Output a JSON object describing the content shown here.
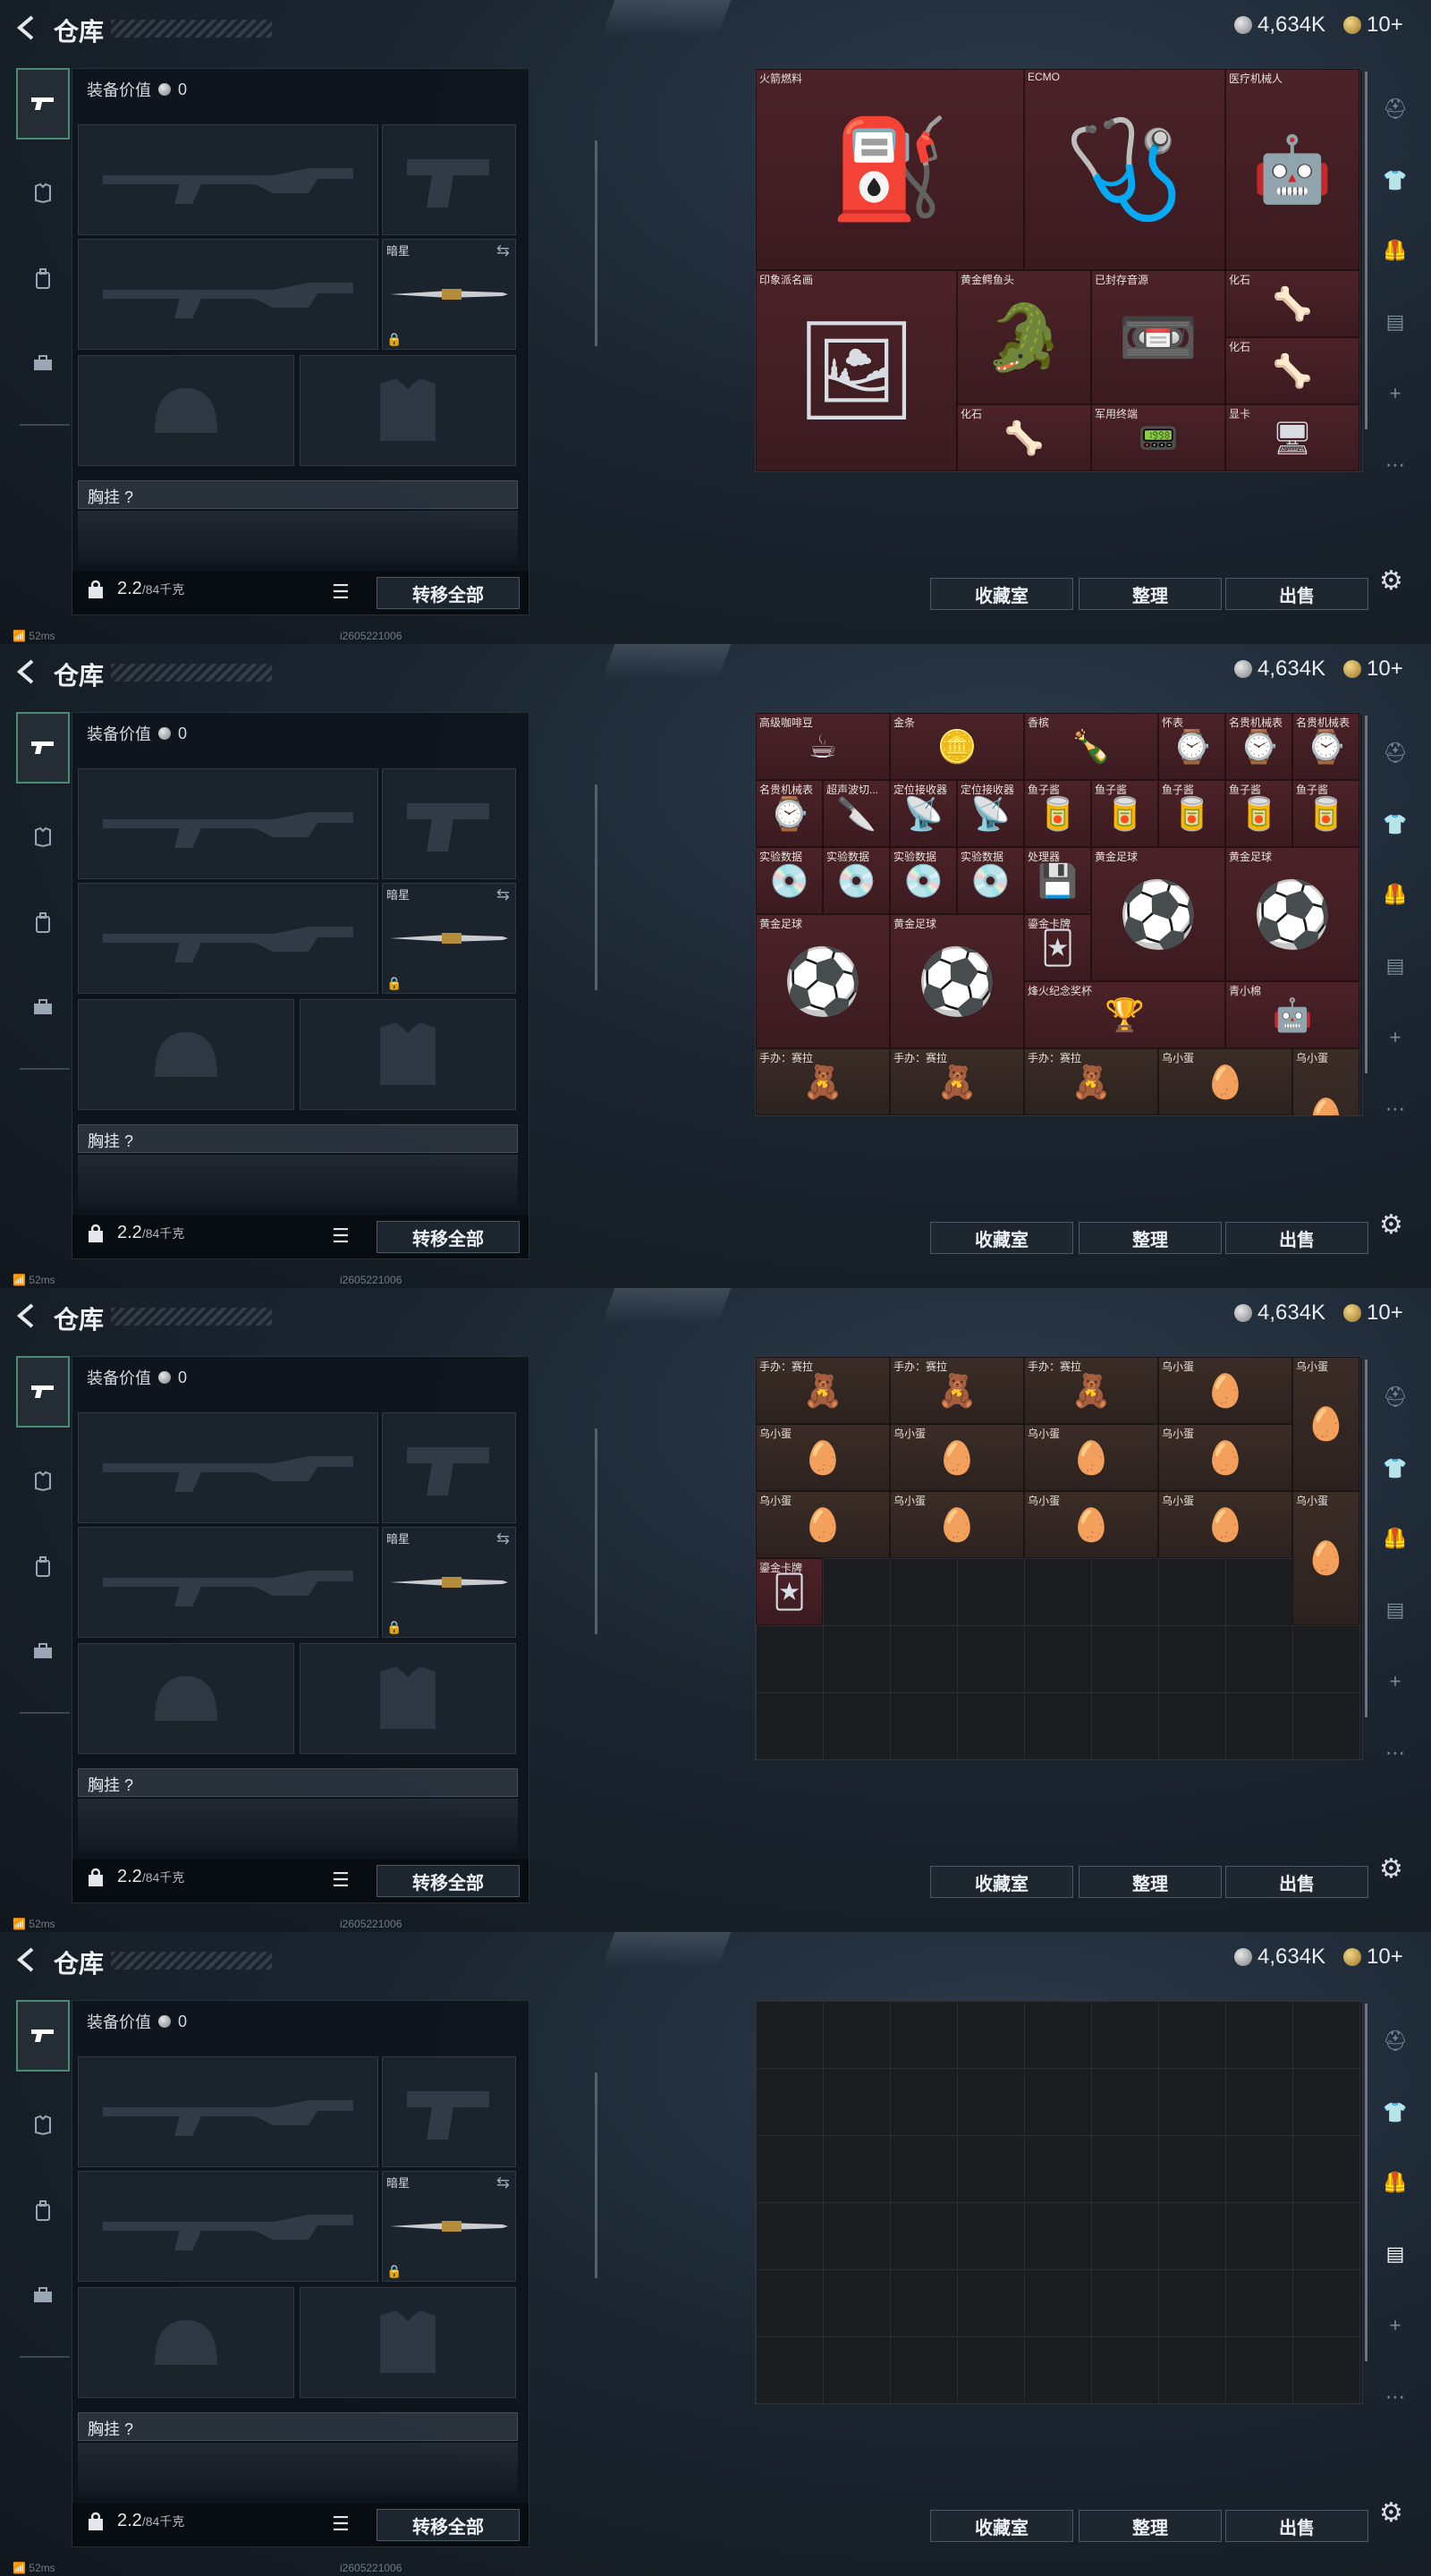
{
  "header": {
    "back_icon": "chevron-left-icon",
    "title": "仓库",
    "silver": "4,634K",
    "gold": "10+"
  },
  "left_tabs": [
    "pistol-icon",
    "armor-icon",
    "backpack-icon",
    "briefcase-icon"
  ],
  "equipment": {
    "value_label": "装备价值",
    "value": "0",
    "knife_label": "暗星",
    "chest_label": "胸挂 ?",
    "weight": "2.2",
    "weight_max": "/84千克",
    "transfer_all": "转移全部"
  },
  "status": {
    "ping": "52ms",
    "uid": "i2605221006"
  },
  "actions": {
    "collection": "收藏室",
    "sort": "整理",
    "sell": "出售"
  },
  "stash_pages": [
    {
      "items": [
        {
          "label": "火箭燃料",
          "glyph": "⛽",
          "color": "red",
          "c": 0,
          "r": 0,
          "w": 4,
          "h": 3
        },
        {
          "label": "ECMO",
          "glyph": "🩺",
          "color": "red",
          "c": 4,
          "r": 0,
          "w": 3,
          "h": 3
        },
        {
          "label": "医疗机械人",
          "glyph": "🤖",
          "color": "red",
          "c": 7,
          "r": 0,
          "w": 2,
          "h": 3
        },
        {
          "label": "印象派名画",
          "glyph": "🖼",
          "color": "red",
          "c": 0,
          "r": 3,
          "w": 3,
          "h": 3
        },
        {
          "label": "黄金鳄鱼头",
          "glyph": "🐊",
          "color": "red",
          "c": 3,
          "r": 3,
          "w": 2,
          "h": 2
        },
        {
          "label": "已封存音源",
          "glyph": "📼",
          "color": "red",
          "c": 5,
          "r": 3,
          "w": 2,
          "h": 2
        },
        {
          "label": "化石",
          "glyph": "🦴",
          "color": "red",
          "c": 7,
          "r": 3,
          "w": 2,
          "h": 1
        },
        {
          "label": "化石",
          "glyph": "🦴",
          "color": "red",
          "c": 7,
          "r": 4,
          "w": 2,
          "h": 1
        },
        {
          "label": "化石",
          "glyph": "🦴",
          "color": "red",
          "c": 3,
          "r": 5,
          "w": 2,
          "h": 1
        },
        {
          "label": "军用终端",
          "glyph": "📟",
          "color": "red",
          "c": 5,
          "r": 5,
          "w": 2,
          "h": 1
        },
        {
          "label": "显卡",
          "glyph": "🖥",
          "color": "red",
          "c": 7,
          "r": 5,
          "w": 2,
          "h": 1
        }
      ]
    },
    {
      "items": [
        {
          "label": "高级咖啡豆",
          "glyph": "☕",
          "color": "red",
          "c": 0,
          "r": 0,
          "w": 2,
          "h": 1
        },
        {
          "label": "金条",
          "glyph": "🪙",
          "color": "red",
          "c": 2,
          "r": 0,
          "w": 2,
          "h": 1
        },
        {
          "label": "香槟",
          "glyph": "🍾",
          "color": "red",
          "c": 4,
          "r": 0,
          "w": 2,
          "h": 1
        },
        {
          "label": "怀表",
          "glyph": "⌚",
          "color": "red",
          "c": 6,
          "r": 0,
          "w": 1,
          "h": 1
        },
        {
          "label": "名贵机械表",
          "glyph": "⌚",
          "color": "red",
          "c": 7,
          "r": 0,
          "w": 1,
          "h": 1
        },
        {
          "label": "名贵机械表",
          "glyph": "⌚",
          "color": "red",
          "c": 8,
          "r": 0,
          "w": 1,
          "h": 1
        },
        {
          "label": "名贵机械表",
          "glyph": "⌚",
          "color": "red",
          "c": 0,
          "r": 1,
          "w": 1,
          "h": 1
        },
        {
          "label": "超声波切...",
          "glyph": "🔪",
          "color": "red",
          "c": 1,
          "r": 1,
          "w": 1,
          "h": 1
        },
        {
          "label": "定位接收器",
          "glyph": "📡",
          "color": "red",
          "c": 2,
          "r": 1,
          "w": 1,
          "h": 1
        },
        {
          "label": "定位接收器",
          "glyph": "📡",
          "color": "red",
          "c": 3,
          "r": 1,
          "w": 1,
          "h": 1
        },
        {
          "label": "鱼子酱",
          "glyph": "🥫",
          "color": "red",
          "c": 4,
          "r": 1,
          "w": 1,
          "h": 1
        },
        {
          "label": "鱼子酱",
          "glyph": "🥫",
          "color": "red",
          "c": 5,
          "r": 1,
          "w": 1,
          "h": 1
        },
        {
          "label": "鱼子酱",
          "glyph": "🥫",
          "color": "red",
          "c": 6,
          "r": 1,
          "w": 1,
          "h": 1
        },
        {
          "label": "鱼子酱",
          "glyph": "🥫",
          "color": "red",
          "c": 7,
          "r": 1,
          "w": 1,
          "h": 1
        },
        {
          "label": "鱼子酱",
          "glyph": "🥫",
          "color": "red",
          "c": 8,
          "r": 1,
          "w": 1,
          "h": 1
        },
        {
          "label": "实验数据",
          "glyph": "💿",
          "color": "red",
          "c": 0,
          "r": 2,
          "w": 1,
          "h": 1
        },
        {
          "label": "实验数据",
          "glyph": "💿",
          "color": "red",
          "c": 1,
          "r": 2,
          "w": 1,
          "h": 1
        },
        {
          "label": "实验数据",
          "glyph": "💿",
          "color": "red",
          "c": 2,
          "r": 2,
          "w": 1,
          "h": 1
        },
        {
          "label": "实验数据",
          "glyph": "💿",
          "color": "red",
          "c": 3,
          "r": 2,
          "w": 1,
          "h": 1
        },
        {
          "label": "处理器",
          "glyph": "💾",
          "color": "red",
          "c": 4,
          "r": 2,
          "w": 1,
          "h": 1
        },
        {
          "label": "黄金足球",
          "glyph": "⚽",
          "color": "red",
          "c": 5,
          "r": 2,
          "w": 2,
          "h": 2
        },
        {
          "label": "黄金足球",
          "glyph": "⚽",
          "color": "red",
          "c": 7,
          "r": 2,
          "w": 2,
          "h": 2
        },
        {
          "label": "黄金足球",
          "glyph": "⚽",
          "color": "red",
          "c": 0,
          "r": 3,
          "w": 2,
          "h": 2
        },
        {
          "label": "黄金足球",
          "glyph": "⚽",
          "color": "red",
          "c": 2,
          "r": 3,
          "w": 2,
          "h": 2
        },
        {
          "label": "鎏金卡牌",
          "glyph": "🃏",
          "color": "red",
          "c": 4,
          "r": 3,
          "w": 1,
          "h": 1
        },
        {
          "label": "烽火纪念奖杯",
          "glyph": "🏆",
          "color": "red",
          "c": 4,
          "r": 4,
          "w": 3,
          "h": 1
        },
        {
          "label": "青小棉",
          "glyph": "🤖",
          "color": "red",
          "c": 7,
          "r": 4,
          "w": 2,
          "h": 1
        },
        {
          "label": "手办：赛拉",
          "glyph": "🧸",
          "color": "brown",
          "c": 0,
          "r": 5,
          "w": 2,
          "h": 1
        },
        {
          "label": "手办：赛拉",
          "glyph": "🧸",
          "color": "brown",
          "c": 2,
          "r": 5,
          "w": 2,
          "h": 1
        },
        {
          "label": "手办：赛拉",
          "glyph": "🧸",
          "color": "brown",
          "c": 4,
          "r": 5,
          "w": 2,
          "h": 1
        },
        {
          "label": "乌小蛋",
          "glyph": "🥚",
          "color": "brown",
          "c": 6,
          "r": 5,
          "w": 2,
          "h": 1
        },
        {
          "label": "乌小蛋",
          "glyph": "🥚",
          "color": "brown",
          "c": 8,
          "r": 5,
          "w": 1,
          "h": 2
        },
        {
          "label": "乌小蛋",
          "glyph": "🥚",
          "color": "brown",
          "c": 0,
          "r": 6,
          "w": 2,
          "h": 1
        },
        {
          "label": "乌小蛋",
          "glyph": "🥚",
          "color": "brown",
          "c": 2,
          "r": 6,
          "w": 2,
          "h": 1
        },
        {
          "label": "乌小蛋",
          "glyph": "🥚",
          "color": "brown",
          "c": 4,
          "r": 6,
          "w": 2,
          "h": 1
        },
        {
          "label": "乌小蛋",
          "glyph": "🥚",
          "color": "brown",
          "c": 6,
          "r": 6,
          "w": 2,
          "h": 1
        },
        {
          "label": "乌小蛋",
          "glyph": "🥚",
          "color": "brown",
          "c": 0,
          "r": 7,
          "w": 2,
          "h": 1
        },
        {
          "label": "乌小蛋",
          "glyph": "🥚",
          "color": "brown",
          "c": 2,
          "r": 7,
          "w": 2,
          "h": 1
        },
        {
          "label": "乌小蛋",
          "glyph": "🥚",
          "color": "brown",
          "c": 4,
          "r": 7,
          "w": 2,
          "h": 1
        },
        {
          "label": "乌小蛋",
          "glyph": "🥚",
          "color": "brown",
          "c": 6,
          "r": 7,
          "w": 2,
          "h": 1
        },
        {
          "label": "乌小蛋",
          "glyph": "🥚",
          "color": "brown",
          "c": 8,
          "r": 7,
          "w": 1,
          "h": 1
        }
      ]
    },
    {
      "items": [
        {
          "label": "手办：赛拉",
          "glyph": "🧸",
          "color": "brown",
          "c": 0,
          "r": 0,
          "w": 2,
          "h": 1
        },
        {
          "label": "手办：赛拉",
          "glyph": "🧸",
          "color": "brown",
          "c": 2,
          "r": 0,
          "w": 2,
          "h": 1
        },
        {
          "label": "手办：赛拉",
          "glyph": "🧸",
          "color": "brown",
          "c": 4,
          "r": 0,
          "w": 2,
          "h": 1
        },
        {
          "label": "乌小蛋",
          "glyph": "🥚",
          "color": "brown",
          "c": 6,
          "r": 0,
          "w": 2,
          "h": 1
        },
        {
          "label": "乌小蛋",
          "glyph": "🥚",
          "color": "brown",
          "c": 8,
          "r": 0,
          "w": 1,
          "h": 2
        },
        {
          "label": "乌小蛋",
          "glyph": "🥚",
          "color": "brown",
          "c": 0,
          "r": 1,
          "w": 2,
          "h": 1
        },
        {
          "label": "乌小蛋",
          "glyph": "🥚",
          "color": "brown",
          "c": 2,
          "r": 1,
          "w": 2,
          "h": 1
        },
        {
          "label": "乌小蛋",
          "glyph": "🥚",
          "color": "brown",
          "c": 4,
          "r": 1,
          "w": 2,
          "h": 1
        },
        {
          "label": "乌小蛋",
          "glyph": "🥚",
          "color": "brown",
          "c": 6,
          "r": 1,
          "w": 2,
          "h": 1
        },
        {
          "label": "乌小蛋",
          "glyph": "🥚",
          "color": "brown",
          "c": 0,
          "r": 2,
          "w": 2,
          "h": 1
        },
        {
          "label": "乌小蛋",
          "glyph": "🥚",
          "color": "brown",
          "c": 2,
          "r": 2,
          "w": 2,
          "h": 1
        },
        {
          "label": "乌小蛋",
          "glyph": "🥚",
          "color": "brown",
          "c": 4,
          "r": 2,
          "w": 2,
          "h": 1
        },
        {
          "label": "乌小蛋",
          "glyph": "🥚",
          "color": "brown",
          "c": 6,
          "r": 2,
          "w": 2,
          "h": 1
        },
        {
          "label": "乌小蛋",
          "glyph": "🥚",
          "color": "brown",
          "c": 8,
          "r": 2,
          "w": 1,
          "h": 2
        },
        {
          "label": "鎏金卡牌",
          "glyph": "🃏",
          "color": "red",
          "c": 0,
          "r": 3,
          "w": 1,
          "h": 1
        }
      ]
    },
    {
      "items": []
    }
  ],
  "right_tabs": [
    "helmet-icon",
    "shirt-icon",
    "armor-icon",
    "page-icon",
    "add-icon",
    "dots-icon"
  ],
  "colors": {
    "accent": "#4a8a73",
    "red_item": "#4b2227",
    "brown_item": "#3b2c26"
  }
}
